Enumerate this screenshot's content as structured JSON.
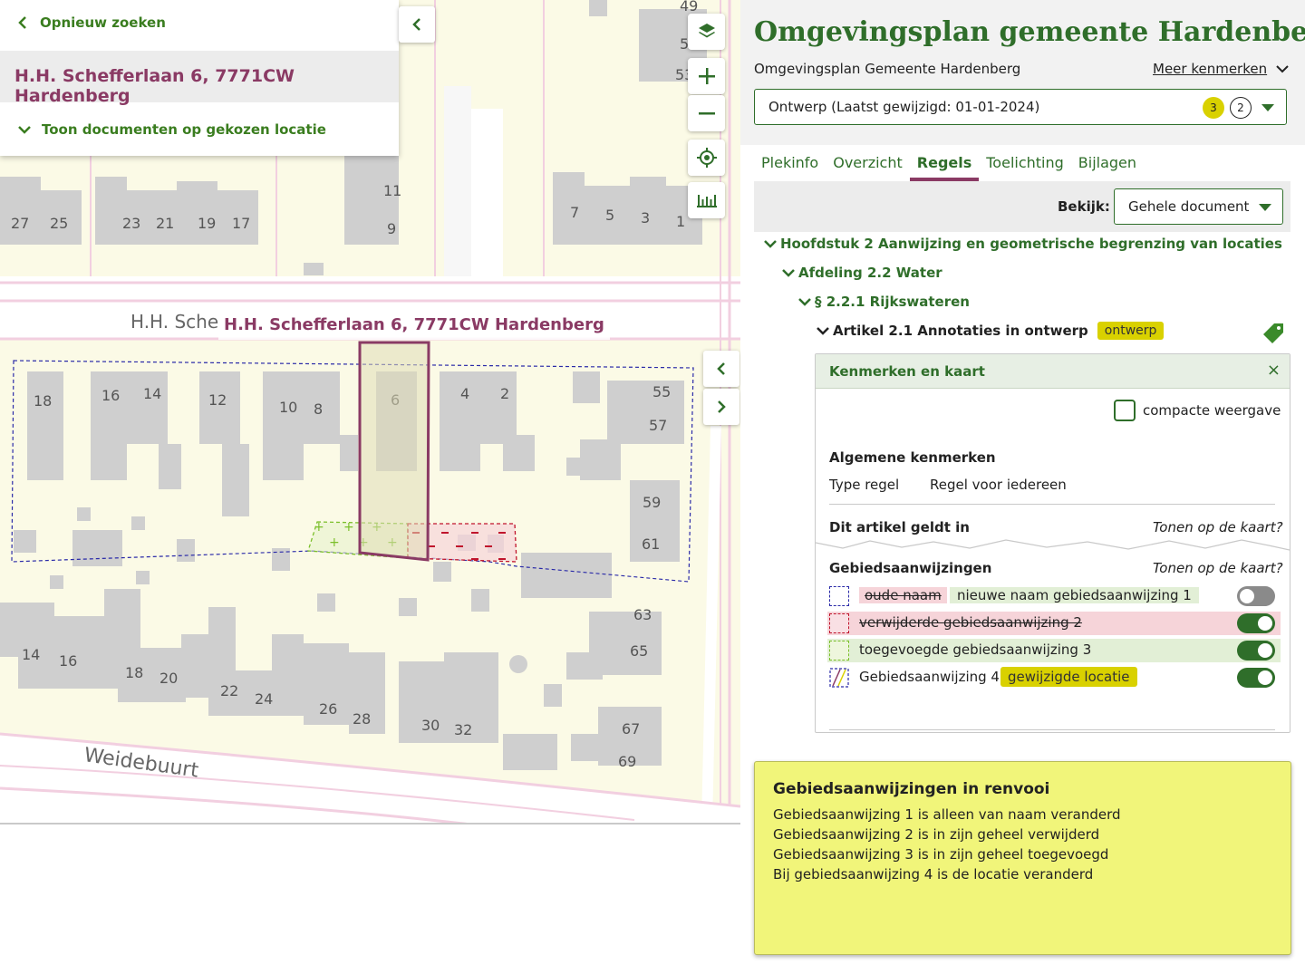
{
  "search_card": {
    "back_label": "Opnieuw zoeken",
    "address": "H.H. Schefferlaan 6, 7771CW Hardenberg",
    "toggle_documents_label": "Toon documenten op gekozen locatie"
  },
  "map": {
    "selected_address_label": "H.H. Schefferlaan 6, 7771CW Hardenberg",
    "street_names": [
      "H.H. Sche",
      "Weidebuurt"
    ],
    "house_numbers_top": [
      "27",
      "25",
      "23",
      "21",
      "19",
      "17",
      "11",
      "9",
      "7",
      "5",
      "3",
      "1",
      "49",
      "5",
      "53"
    ],
    "house_numbers_middle": [
      "18",
      "16",
      "14",
      "12",
      "10",
      "8",
      "6",
      "4",
      "2",
      "55",
      "57",
      "59",
      "61"
    ],
    "house_numbers_bottom": [
      "14",
      "16",
      "18",
      "20",
      "22",
      "24",
      "26",
      "28",
      "30",
      "32",
      "63",
      "65",
      "67",
      "69"
    ],
    "controls": [
      "layers-icon",
      "zoom-in-icon",
      "zoom-out-icon",
      "locate-icon",
      "measure-icon"
    ]
  },
  "panel": {
    "title": "Omgevingsplan gemeente Hardenberg",
    "subtitle": "Omgevingsplan Gemeente Hardenberg",
    "more_link": "Meer kenmerken",
    "version_select": {
      "value": "Ontwerp (Laatst gewijzigd: 01-01-2024)",
      "count_a": "3",
      "count_b": "2"
    },
    "tabs": [
      "Plekinfo",
      "Overzicht",
      "Regels",
      "Toelichting",
      "Bijlagen"
    ],
    "active_tab": "Regels",
    "bekijk_label": "Bekijk:",
    "bekijk_value": "Gehele document",
    "tree": {
      "chapter": "Hoofdstuk 2 Aanwijzing en geometrische begrenzing van locaties",
      "section": "Afdeling 2.2 Water",
      "paragraph": "§ 2.2.1 Rijkswateren",
      "article": "Artikel 2.1 Annotaties in ontwerp",
      "article_badge": "ontwerp"
    },
    "kenmerken": {
      "title": "Kenmerken en kaart",
      "close": "×",
      "compact_label": "compacte weergave",
      "general_heading": "Algemene kenmerken",
      "type_label": "Type regel",
      "type_value": "Regel voor iedereen",
      "applies_heading": "Dit artikel geldt in",
      "show_on_map": "Tonen op de kaart?",
      "ga_heading": "Gebiedsaanwijzingen",
      "ga_show_on_map": "Tonen op de kaart?",
      "rows": [
        {
          "old": "oude naam",
          "new": "nieuwe naam gebiedsaanwijzing 1",
          "on": false
        },
        {
          "label": "verwijderde gebiedsaanwijzing 2",
          "on": true
        },
        {
          "label": "toegevoegde gebiedsaanwijzing 3",
          "on": true
        },
        {
          "label": "Gebiedsaanwijzing 4",
          "badge": "gewijzigde locatie",
          "on": true
        }
      ]
    }
  },
  "renvooi": {
    "title": "Gebiedsaanwijzingen in renvooi",
    "lines": [
      "Gebiedsaanwijzing 1 is alleen van naam veranderd",
      "Gebiedsaanwijzing 2 is in zijn geheel verwijderd",
      "Gebiedsaanwijzing 3 is in zijn geheel toegevoegd",
      "Bij gebiedsaanwijzing 4 is de locatie veranderd"
    ]
  },
  "colors": {
    "green": "#2f6e2a",
    "purple": "#8a3a64",
    "yellow_badge": "#d9d100",
    "renvooi_bg": "#f1f57a",
    "map_bg": "#fbfae6",
    "building": "#cfcfcf"
  }
}
